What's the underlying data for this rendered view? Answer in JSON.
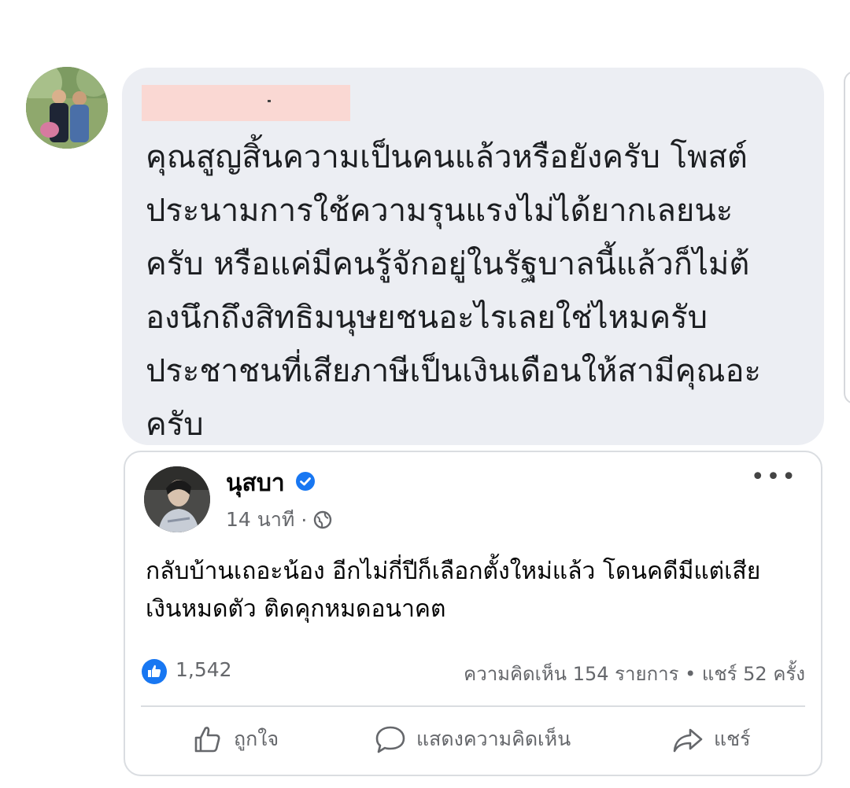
{
  "comment": {
    "text": "คุณสูญสิ้นความเป็นคนแล้วหรือยังครับ โพสต์\nประนามการใช้ความรุนแรงไม่ได้ยากเลยนะ\nครับ หรือแค่มีคนรู้จักอยู่ในรัฐบาลนี้แล้วก็ไม่ต้\nองนึกถึงสิทธิมนุษยชนอะไรเลยใช่ไหมครับ\nประชาชนที่เสียภาษีเป็นเงินเดือนให้สามีคุณอะ\nครับ",
    "bubble_color": "#eceef3",
    "redaction_color": "#fad8d3"
  },
  "post": {
    "author": "นุสบา",
    "time": "14 นาที",
    "separator": "·",
    "more": "•••",
    "text": "กลับบ้านเถอะน้อง อีกไม่กี่ปีก็เลือกตั้งใหม่แล้ว โดนคดีมีแต่เสีย\nเงินหมดตัว ติดคุกหมดอนาคต",
    "like_count": "1,542",
    "stats": "ความคิดเห็น 154 รายการ • แชร์ 52 ครั้ง",
    "verified_color": "#1877f2"
  },
  "actions": {
    "like_label": "ถูกใจ",
    "comment_label": "แสดงความคิดเห็น",
    "share_label": "แชร์"
  },
  "icons": {
    "verified": "verified-badge-icon",
    "globe": "globe-icon",
    "like_badge": "like-badge-icon",
    "like": "thumbs-up-icon",
    "comment": "comment-bubble-icon",
    "share": "share-arrow-icon",
    "more": "more-options-icon"
  }
}
